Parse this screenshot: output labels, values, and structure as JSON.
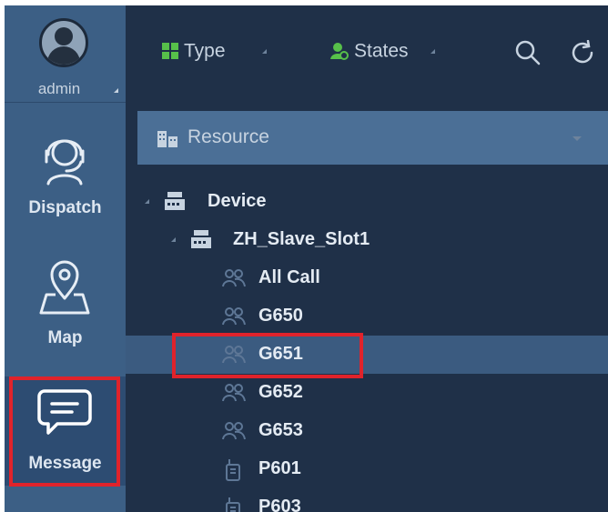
{
  "sidebar": {
    "user": {
      "name": "admin"
    },
    "items": [
      {
        "id": "dispatch",
        "label": "Dispatch",
        "icon": "headset-icon"
      },
      {
        "id": "map",
        "label": "Map",
        "icon": "map-pin-icon"
      },
      {
        "id": "message",
        "label": "Message",
        "icon": "chat-bubble-icon",
        "active": true
      }
    ]
  },
  "toolbar": {
    "type_label": "Type",
    "states_label": "States",
    "search_icon": "search-icon",
    "refresh_icon": "refresh-icon"
  },
  "resource": {
    "label": "Resource"
  },
  "tree": {
    "root": {
      "label": "Device",
      "expanded": true
    },
    "slot": {
      "label": "ZH_Slave_Slot1",
      "expanded": true
    },
    "items": [
      {
        "label": "All Call",
        "icon": "group-call-icon"
      },
      {
        "label": "G650",
        "icon": "group-icon"
      },
      {
        "label": "G651",
        "icon": "group-icon",
        "selected": true
      },
      {
        "label": "G652",
        "icon": "group-icon"
      },
      {
        "label": "G653",
        "icon": "group-icon"
      },
      {
        "label": "P601",
        "icon": "radio-icon"
      },
      {
        "label": "P603",
        "icon": "radio-icon"
      }
    ]
  },
  "colors": {
    "sidebar_bg": "#3c5f85",
    "main_bg": "#1f3048",
    "selected_row": "#3b5b80",
    "highlight": "#e0232b"
  }
}
